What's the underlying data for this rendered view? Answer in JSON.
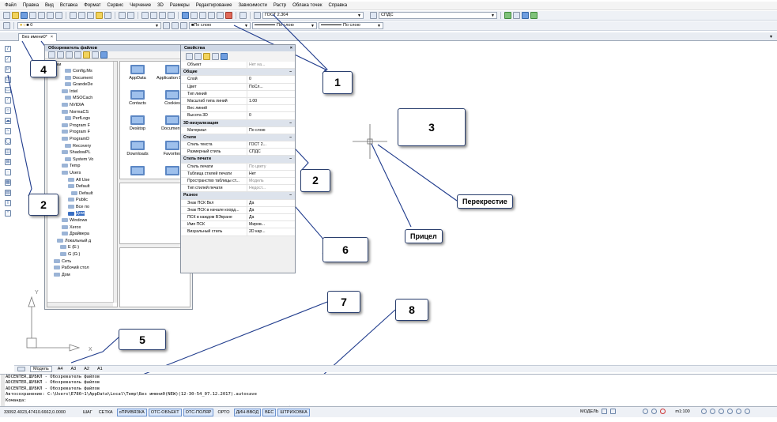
{
  "menu": [
    "Файл",
    "Правка",
    "Вид",
    "Вставка",
    "Формат",
    "Сервис",
    "Черчение",
    "3D",
    "Размеры",
    "Редактирование",
    "Зависимости",
    "Растр",
    "Облака точек",
    "Справка"
  ],
  "toolbar": {
    "text_style": "ГОСТ 2.304",
    "dim_style": "СПДС",
    "layer": "По слою",
    "linetype": "По слою",
    "lineweight": "По слою",
    "layer_name": "0"
  },
  "document_tab": {
    "title": "Без имени0*",
    "close": "×"
  },
  "tab_menu_arrow": "▾",
  "file_browser": {
    "title": "Обозреватель файлов",
    "close": "×",
    "tree_label": "Папки",
    "tree": [
      {
        "label": "Config.Ms",
        "selected": false
      },
      {
        "label": "Document",
        "selected": false
      },
      {
        "label": "GrandeDe",
        "selected": false
      },
      {
        "label": "Intel",
        "selected": false
      },
      {
        "label": "MSOCach",
        "selected": false
      },
      {
        "label": "NVIDIA",
        "selected": false
      },
      {
        "label": "NormaCS",
        "selected": false
      },
      {
        "label": "PerfLogs",
        "selected": false
      },
      {
        "label": "Program F",
        "selected": false
      },
      {
        "label": "Program F",
        "selected": false
      },
      {
        "label": "ProgramD",
        "selected": false
      },
      {
        "label": "Recovery",
        "selected": false
      },
      {
        "label": "ShadowPL",
        "selected": false
      },
      {
        "label": "System Vo",
        "selected": false
      },
      {
        "label": "Temp",
        "selected": false
      },
      {
        "label": "Users",
        "selected": false
      },
      {
        "label": "All Use",
        "selected": false
      },
      {
        "label": "Default",
        "selected": false
      },
      {
        "label": "Default",
        "selected": false
      },
      {
        "label": "Public",
        "selected": false
      },
      {
        "label": "Все по",
        "selected": false
      },
      {
        "label": "Дом",
        "selected": true
      },
      {
        "label": "Windows",
        "selected": false
      },
      {
        "label": "Xerox",
        "selected": false
      },
      {
        "label": "Драйвера",
        "selected": false
      },
      {
        "label": "Локальный д",
        "selected": false
      },
      {
        "label": "E (E:)",
        "selected": false
      },
      {
        "label": "G (G:)",
        "selected": false
      },
      {
        "label": "Сеть",
        "selected": false
      },
      {
        "label": "Рабочий стол",
        "selected": false
      },
      {
        "label": "Дом",
        "selected": false
      }
    ],
    "folders": [
      "AppData",
      "Application Data",
      "Contacts",
      "Cookies",
      "Desktop",
      "Documents",
      "Downloads",
      "Favorites"
    ]
  },
  "properties": {
    "title": "Свойства",
    "close": "×",
    "rows": [
      {
        "k": "Объект",
        "v": "Нет на...",
        "sec": false,
        "grey": true
      },
      {
        "k": "Общие",
        "v": "−",
        "sec": true
      },
      {
        "k": "Слой",
        "v": "0",
        "sec": false
      },
      {
        "k": "Цвет",
        "v": "ПоСл...",
        "sec": false
      },
      {
        "k": "Тип линий",
        "v": "",
        "sec": false
      },
      {
        "k": "Масштаб типа линий",
        "v": "1.00",
        "sec": false
      },
      {
        "k": "Вес линий",
        "v": "",
        "sec": false
      },
      {
        "k": "Высота 3D",
        "v": "0",
        "sec": false
      },
      {
        "k": "3D-визуализация",
        "v": "−",
        "sec": true
      },
      {
        "k": "Материал",
        "v": "По слою",
        "sec": false
      },
      {
        "k": "Стили",
        "v": "−",
        "sec": true
      },
      {
        "k": "Стиль текста",
        "v": "ГОСТ 2...",
        "sec": false
      },
      {
        "k": "Размерный стиль",
        "v": "СПДС",
        "sec": false
      },
      {
        "k": "Стиль печати",
        "v": "−",
        "sec": true
      },
      {
        "k": "Стиль печати",
        "v": "По цвету",
        "sec": false,
        "grey": true
      },
      {
        "k": "Таблица стилей печати",
        "v": "Нет",
        "sec": false
      },
      {
        "k": "Пространство таблицы ст...",
        "v": "Модель",
        "sec": false,
        "grey": true
      },
      {
        "k": "Тип стилей печати",
        "v": "Недост...",
        "sec": false,
        "grey": true
      },
      {
        "k": "Разное",
        "v": "−",
        "sec": true
      },
      {
        "k": "Знак ПСК Вкл",
        "v": "Да",
        "sec": false
      },
      {
        "k": "Знак ПСК в начале коорд...",
        "v": "Да",
        "sec": false
      },
      {
        "k": "ПСК в каждом ВЭкране",
        "v": "Да",
        "sec": false
      },
      {
        "k": "Имя ПСК",
        "v": "Миров...",
        "sec": false
      },
      {
        "k": "Визуальный стиль",
        "v": "2D кар...",
        "sec": false
      }
    ]
  },
  "ucs": {
    "y": "Y",
    "x": "X"
  },
  "callouts": [
    "1",
    "2",
    "3",
    "2",
    "4",
    "5",
    "6",
    "7",
    "8"
  ],
  "labels": {
    "crosshair": "Перекрестие",
    "aperture": "Прицел"
  },
  "layout_tabs": [
    "Модель",
    "А4",
    "А3",
    "А2",
    "А1"
  ],
  "command_history": [
    "ADCENTER,ШУБКЛ - Обозреватель файлов",
    "ADCENTER,ШУБКЛ - Обозреватель файлов",
    "ADCENTER,ШУБКЛ - Обозреватель файлов",
    "Автосохранение: C:\\Users\\E786~1\\AppData\\Local\\Temp\\Без имени0(NEW)(12-30-54_07.12.2017).autosave",
    "Команда:"
  ],
  "status": {
    "coords": "33092.4023,47410.6662,0.0000",
    "buttons": [
      {
        "label": "ШАГ",
        "on": false
      },
      {
        "label": "СЕТКА",
        "on": false
      },
      {
        "label": "оПРИВЯЗКА",
        "on": true
      },
      {
        "label": "ОТС-ОБЪЕКТ",
        "on": true
      },
      {
        "label": "ОТС-ПОЛЯР",
        "on": true
      },
      {
        "label": "ОРТО",
        "on": false
      },
      {
        "label": "ДИН-ВВОД",
        "on": true
      },
      {
        "label": "ВЕС",
        "on": true
      },
      {
        "label": "ШТРИХОВКА",
        "on": true
      }
    ],
    "model": "МОДЕЛЬ",
    "scale": "m1:100"
  },
  "colors": {
    "callout_border": "#2a3f6e",
    "leader": "#1f3b8c",
    "active_status": "#dbe8fb"
  }
}
